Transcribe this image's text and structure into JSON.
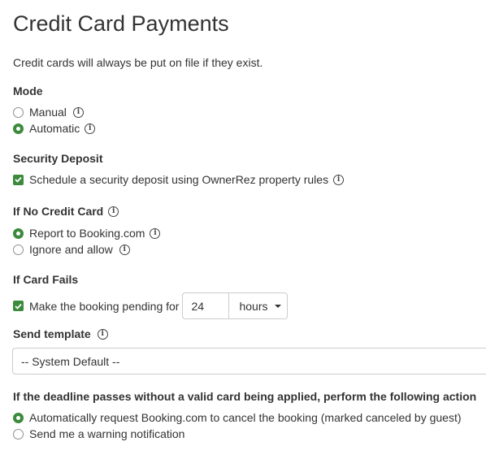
{
  "page": {
    "title": "Credit Card Payments",
    "intro": "Credit cards will always be put on file if they exist."
  },
  "mode": {
    "heading": "Mode",
    "options": [
      {
        "label": "Manual",
        "checked": false,
        "icon": "info-icon"
      },
      {
        "label": "Automatic",
        "checked": true,
        "icon": "info-icon"
      }
    ]
  },
  "security_deposit": {
    "heading": "Security Deposit",
    "checkbox_label": "Schedule a security deposit using OwnerRez property rules",
    "checked": true
  },
  "no_credit_card": {
    "heading": "If No Credit Card",
    "options": [
      {
        "label": "Report to Booking.com",
        "checked": true
      },
      {
        "label": "Ignore and allow",
        "checked": false
      }
    ]
  },
  "card_fails": {
    "heading": "If Card Fails",
    "checkbox_label": "Make the booking pending for",
    "checked": true,
    "duration_value": "24",
    "duration_unit": "hours"
  },
  "send_template": {
    "heading": "Send template",
    "selected": "-- System Default --"
  },
  "deadline": {
    "heading": "If the deadline passes without a valid card being applied, perform the following action",
    "options": [
      {
        "label": "Automatically request Booking.com to cancel the booking (marked canceled by guest)",
        "checked": true
      },
      {
        "label": "Send me a warning notification",
        "checked": false
      }
    ]
  },
  "colors": {
    "accent": "#3c8a3c",
    "text": "#333333",
    "border": "#cccccc"
  }
}
